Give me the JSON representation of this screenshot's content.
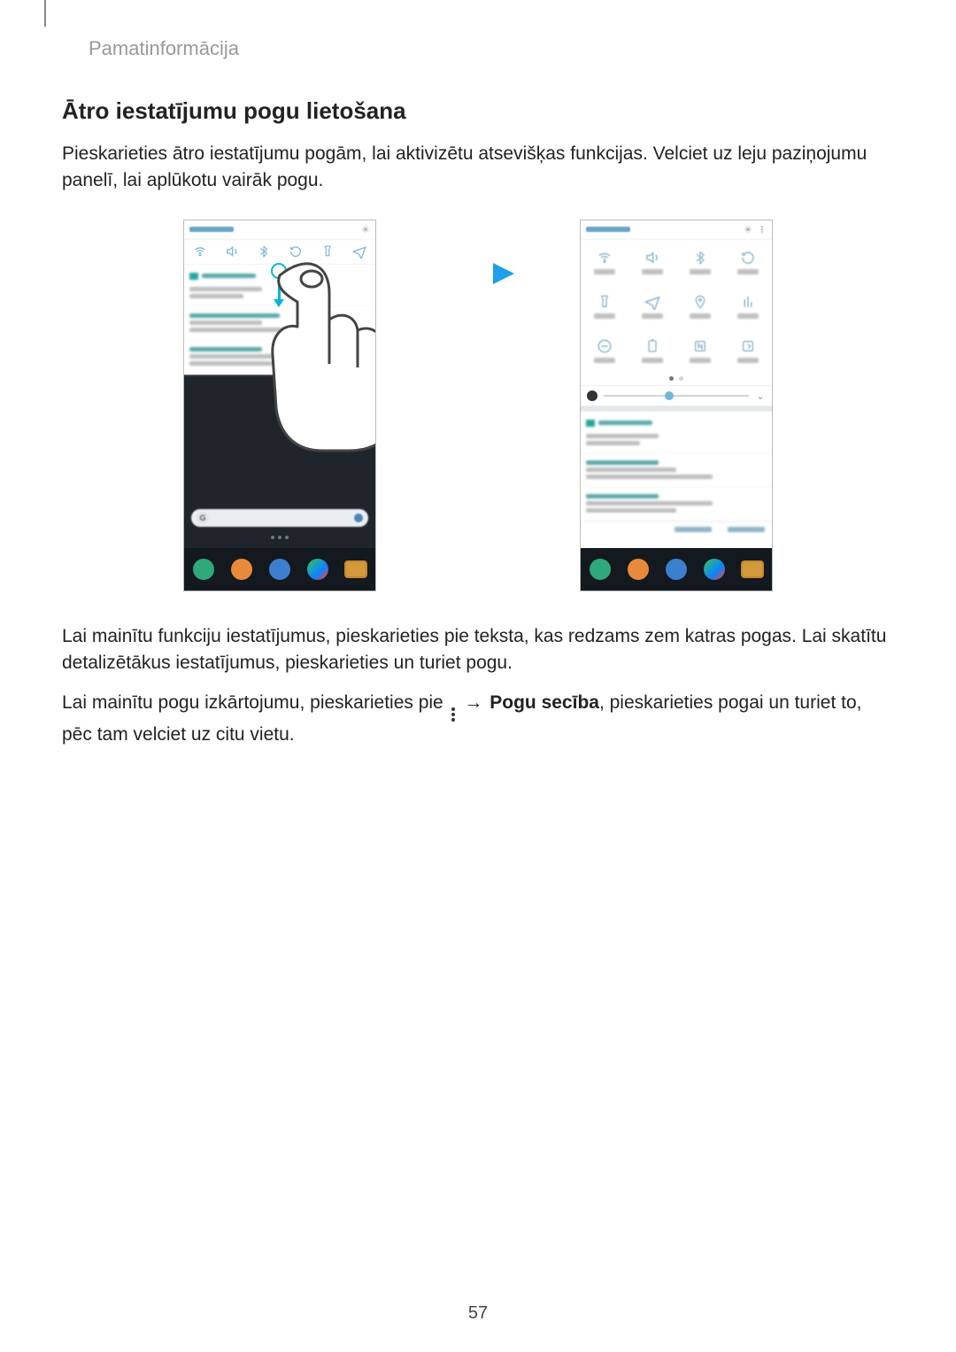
{
  "header": {
    "section": "Pamatinformācija"
  },
  "section_title": "Ātro iestatījumu pogu lietošana",
  "para1": "Pieskarieties ātro iestatījumu pogām, lai aktivizētu atsevišķas funkcijas. Velciet uz leju paziņojumu panelī, lai aplūkotu vairāk pogu.",
  "para2": "Lai mainītu funkciju iestatījumus, pieskarieties pie teksta, kas redzams zem katras pogas. Lai skatītu detalizētākus iestatījumus, pieskarieties un turiet pogu.",
  "para3_a": "Lai mainītu pogu izkārtojumu, pieskarieties pie ",
  "para3_arrow": "→",
  "para3_bold": "Pogu secība",
  "para3_b": ", pieskarieties pogai un turiet to, pēc tam velciet uz citu vietu.",
  "page_number": "57",
  "google_badge": "G"
}
